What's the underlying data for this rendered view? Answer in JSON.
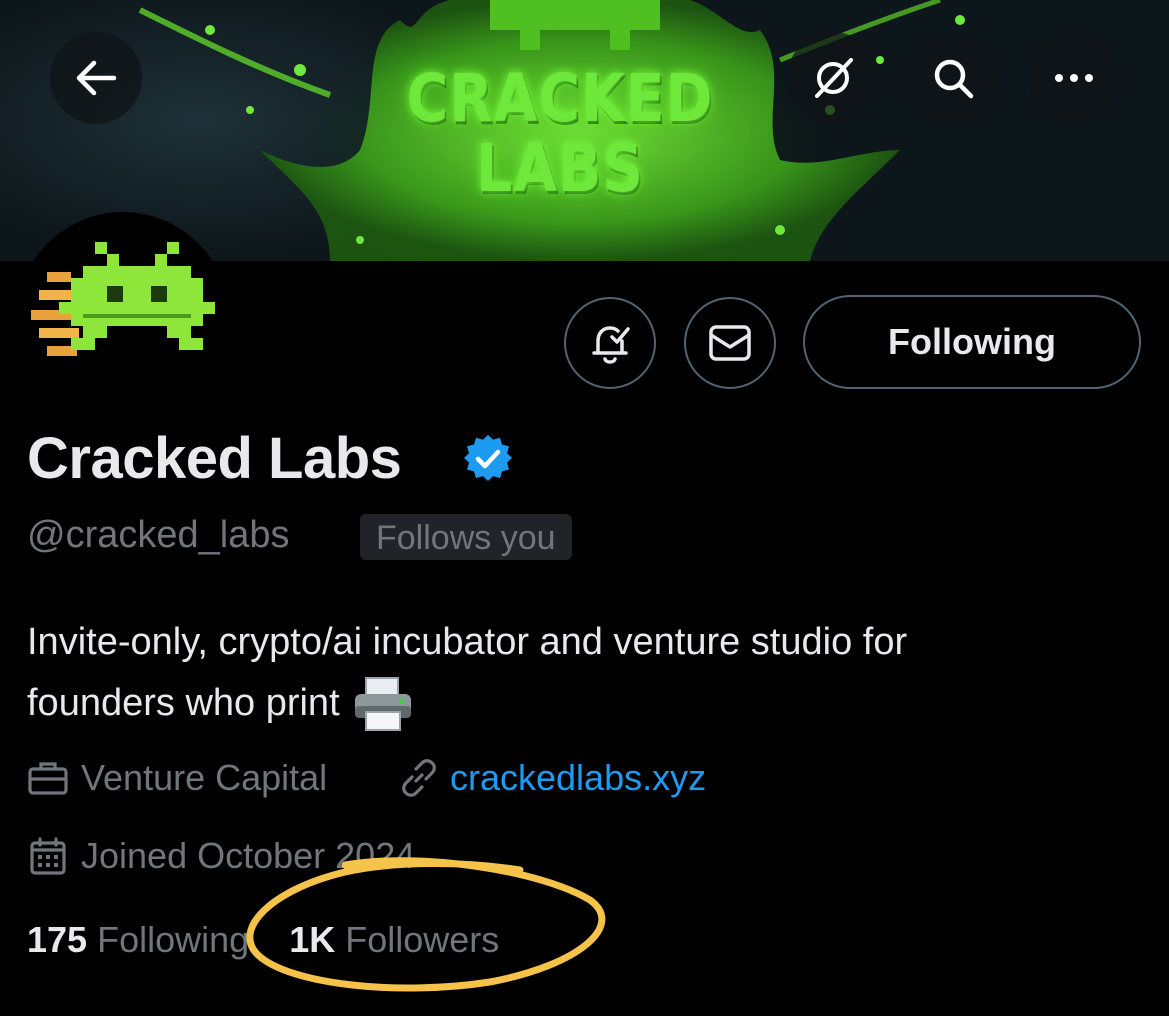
{
  "banner": {
    "title_line1": "CRACKED",
    "title_line2": "LABS"
  },
  "nav": {
    "back_icon": "arrow-left-icon",
    "grok_icon": "grok-icon",
    "search_icon": "search-icon",
    "more_icon": "more-icon"
  },
  "actions": {
    "notify_icon": "bell-check-icon",
    "message_icon": "envelope-icon",
    "follow_label": "Following"
  },
  "profile": {
    "name": "Cracked Labs",
    "handle": "@cracked_labs",
    "follows_you": "Follows you",
    "bio_line1": "Invite-only, crypto/ai incubator and venture studio for",
    "bio_line2": "founders who print",
    "bio_emoji": "printer-emoji",
    "category": "Venture Capital",
    "website": "crackedlabs.xyz",
    "joined": "Joined October 2024"
  },
  "stats": {
    "following_count": "175",
    "following_label": "Following",
    "followers_count": "1K",
    "followers_label": "Followers"
  },
  "colors": {
    "background": "#000000",
    "text": "#e7e9ea",
    "muted": "#71767b",
    "link": "#1d9bf0",
    "verified": "#1d9bf0",
    "annotation": "#f5c24a",
    "banner_glow": "#6ee83a"
  }
}
